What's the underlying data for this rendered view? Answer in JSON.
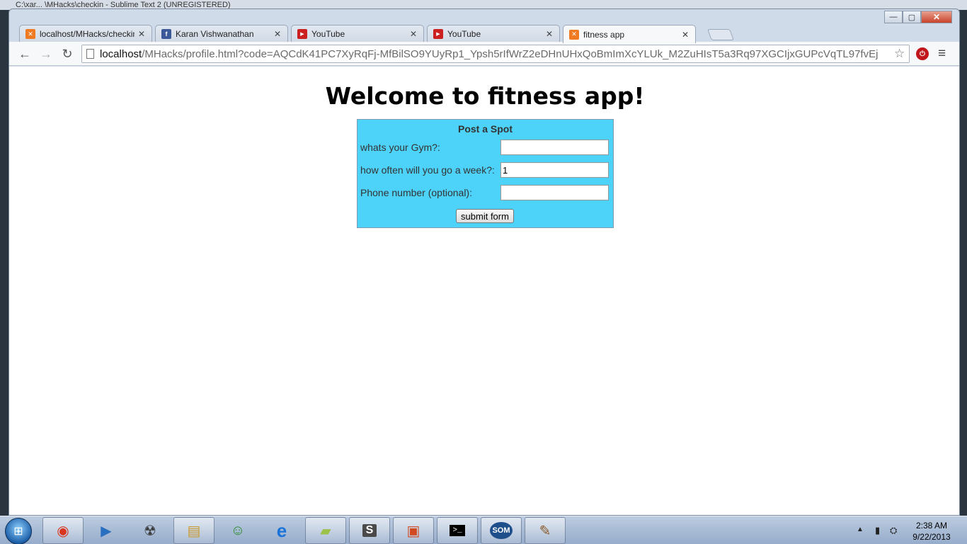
{
  "background_window": {
    "title_text": "C:\\xar... \\MHacks\\checkin - Sublime Text 2 (UNREGISTERED)"
  },
  "window_controls": {
    "minimize": "—",
    "maximize": "▢",
    "close": "✕"
  },
  "tabs": [
    {
      "title": "localhost/MHacks/checkin",
      "favicon": "xampp-icon",
      "active": false
    },
    {
      "title": "Karan Vishwanathan",
      "favicon": "facebook-icon",
      "active": false
    },
    {
      "title": "YouTube",
      "favicon": "youtube-icon",
      "active": false
    },
    {
      "title": "YouTube",
      "favicon": "youtube-icon",
      "active": false
    },
    {
      "title": "fitness app",
      "favicon": "xampp-icon",
      "active": true
    }
  ],
  "tab_close_glyph": "✕",
  "toolbar": {
    "back": "←",
    "forward": "→",
    "reload": "↻",
    "url_host": "localhost",
    "url_path": "/MHacks/profile.html?code=AQCdK41PC7XyRqFj-MfBilSO9YUyRp1_Ypsh5rIfWrZ2eDHnUHxQoBmImXcYLUk_M2ZuHIsT5a3Rq97XGCIjxGUPcVqTL97fvEj",
    "star": "☆",
    "extension": "⏻",
    "menu": "≡"
  },
  "page": {
    "title": "Welcome to fitness app!",
    "form": {
      "heading": "Post a Spot",
      "gym_label": "whats your Gym?:",
      "gym_value": "",
      "frequency_label": "how often will you go a week?:",
      "frequency_value": "1",
      "phone_label": "Phone number (optional):",
      "phone_value": "",
      "submit_label": "submit form"
    }
  },
  "taskbar": {
    "start_glyph": "⊞",
    "apps": [
      "chrome-icon",
      "media-player-icon",
      "network-icon",
      "explorer-icon",
      "messenger-icon",
      "internet-explorer-icon",
      "sticky-notes-icon",
      "sublime-text-icon",
      "flash-icon",
      "cmd-icon",
      "som-icon",
      "paint-icon"
    ],
    "app_glyphs": [
      "◉",
      "▶",
      "☢",
      "▤",
      "☺",
      "e",
      "▰",
      "S",
      "▣",
      ">_",
      "SOM",
      "✎"
    ],
    "tray_arrow": "▲",
    "tray_battery": "▮",
    "tray_network": "⛭",
    "clock_time": "2:38 AM",
    "clock_date": "9/22/2013"
  },
  "colors": {
    "form_background": "#4dd2f9",
    "chrome_frame": "#cfdbe9"
  }
}
